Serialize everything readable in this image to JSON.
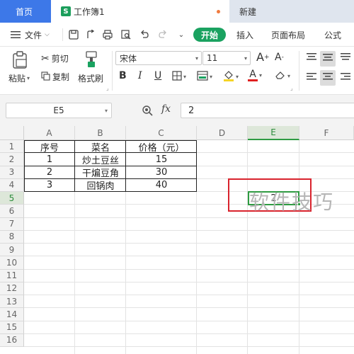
{
  "tabs": {
    "home": "首页",
    "doc_icon": "S",
    "doc": "工作簿1",
    "new": "新建"
  },
  "menu": {
    "file": "文件",
    "start": "开始",
    "insert": "插入",
    "page_layout": "页面布局",
    "formula": "公式"
  },
  "ribbon": {
    "paste": "粘贴",
    "cut": "剪切",
    "copy": "复制",
    "format_painter": "格式刷",
    "font_name": "宋体",
    "font_size": "11",
    "bold": "B",
    "italic": "I",
    "underline": "U",
    "grow_font": "A",
    "shrink_font": "A"
  },
  "formula_bar": {
    "cell_ref": "E5",
    "fx": "fx",
    "value": "2"
  },
  "sheet": {
    "columns": [
      "A",
      "B",
      "C",
      "D",
      "E",
      "F"
    ],
    "rows": [
      "1",
      "2",
      "3",
      "4",
      "5",
      "6",
      "7",
      "8",
      "9",
      "10",
      "11",
      "12",
      "13",
      "14",
      "15",
      "16"
    ],
    "active_column": "E",
    "active_row": "5",
    "table": {
      "header": [
        "序号",
        "菜名",
        "价格（元）"
      ],
      "rows": [
        [
          "1",
          "炒土豆丝",
          "15"
        ],
        [
          "2",
          "干煸豆角",
          "30"
        ],
        [
          "3",
          "回锅肉",
          "40"
        ]
      ]
    },
    "selected_cell_value": "2"
  },
  "watermark": "软件技巧",
  "colors": {
    "accent_green": "#1aa260",
    "home_tab_blue": "#3d78e8",
    "highlight_red": "#d9232d",
    "selection_green": "#2e9b41"
  }
}
